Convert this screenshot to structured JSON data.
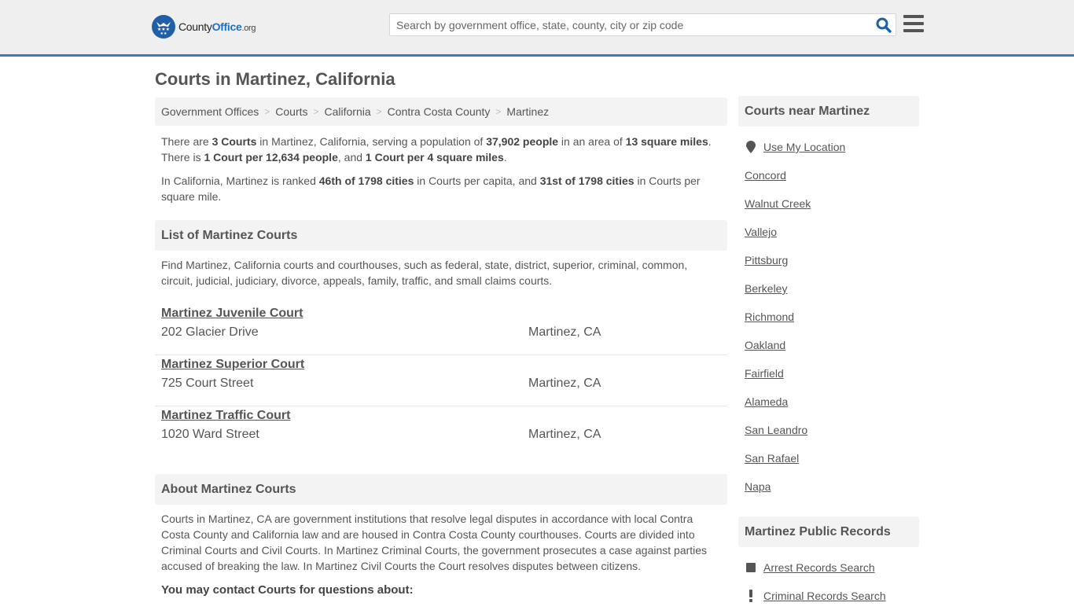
{
  "header": {
    "logo": {
      "part1": "County",
      "part2": "Office",
      "part3": ".org"
    },
    "search": {
      "placeholder": "Search by government office, state, county, city or zip code",
      "value": ""
    },
    "icons": {
      "search": "search-icon",
      "menu": "hamburger-menu-icon"
    }
  },
  "page": {
    "title": "Courts in Martinez, California"
  },
  "breadcrumb": [
    {
      "label": "Government Offices"
    },
    {
      "label": "Courts"
    },
    {
      "label": "California"
    },
    {
      "label": "Contra Costa County"
    },
    {
      "label": "Martinez"
    }
  ],
  "summary": {
    "p1": {
      "t1": "There are ",
      "b1": "3 Courts",
      "t2": " in Martinez, California, serving a population of ",
      "b2": "37,902 people",
      "t3": " in an area of ",
      "b3": "13 square miles",
      "t4": ". There is ",
      "b4": "1 Court per 12,634 people",
      "t5": ", and ",
      "b5": "1 Court per 4 square miles",
      "t6": "."
    },
    "p2": {
      "t1": "In California, Martinez is ranked ",
      "b1": "46th of 1798 cities",
      "t2": " in Courts per capita, and ",
      "b2": "31st of 1798 cities",
      "t3": " in Courts per square mile."
    }
  },
  "list": {
    "heading": "List of Martinez Courts",
    "description": "Find Martinez, California courts and courthouses, such as federal, state, district, superior, criminal, common, circuit, judicial, judiciary, divorce, appeals, family, traffic, and small claims courts.",
    "courts": [
      {
        "name": "Martinez Juvenile Court",
        "address": "202 Glacier Drive",
        "city": "Martinez, CA"
      },
      {
        "name": "Martinez Superior Court",
        "address": "725 Court Street",
        "city": "Martinez, CA"
      },
      {
        "name": "Martinez Traffic Court",
        "address": "1020 Ward Street",
        "city": "Martinez, CA"
      }
    ]
  },
  "about": {
    "heading": "About Martinez Courts",
    "text": "Courts in Martinez, CA are government institutions that resolve legal disputes in accordance with local Contra Costa County and California law and are housed in Contra Costa County courthouses. Courts are divided into Criminal Courts and Civil Courts. In Martinez Criminal Courts, the government prosecutes a case against parties accused of breaking the law. In Martinez Civil Courts the Court resolves disputes between citizens.",
    "contact_heading": "You may contact Courts for questions about:"
  },
  "sidebar": {
    "near": {
      "heading": "Courts near Martinez",
      "use_location": "Use My Location",
      "cities": [
        "Concord",
        "Walnut Creek",
        "Vallejo",
        "Pittsburg",
        "Berkeley",
        "Richmond",
        "Oakland",
        "Fairfield",
        "Alameda",
        "San Leandro",
        "San Rafael",
        "Napa"
      ]
    },
    "records": {
      "heading": "Martinez Public Records",
      "items": [
        {
          "label": "Arrest Records Search",
          "icon": "square-icon"
        },
        {
          "label": "Criminal Records Search",
          "icon": "exclamation-icon"
        }
      ]
    }
  },
  "colors": {
    "accent": "#3a7dbd",
    "brand_blue": "#1f5ea8",
    "header_bg": "#efefef",
    "panel_bg": "#f3f3f3",
    "text": "#555555"
  }
}
